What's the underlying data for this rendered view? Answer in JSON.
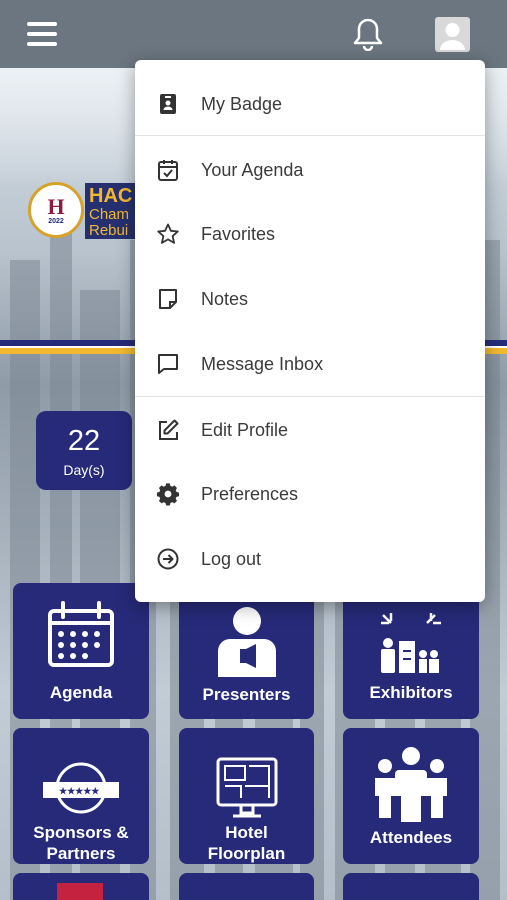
{
  "header": {
    "menu_icon": "hamburger-icon",
    "bell_icon": "bell-icon",
    "avatar_icon": "user-avatar-icon"
  },
  "hero": {
    "logo": {
      "initial": "H",
      "year": "2022",
      "line1": "HAC",
      "line2": "Cham",
      "line3": "Rebui"
    },
    "countdown": {
      "value": "22",
      "unit": "Day(s)"
    }
  },
  "colors": {
    "topbar": "#6b7680",
    "tile": "#262a78",
    "gold": "#f0b930"
  },
  "user_menu": {
    "items": [
      {
        "label": "My Badge",
        "icon": "badge-icon"
      },
      {
        "label": "Your Agenda",
        "icon": "calendar-check-icon"
      },
      {
        "label": "Favorites",
        "icon": "star-icon"
      },
      {
        "label": "Notes",
        "icon": "note-icon"
      },
      {
        "label": "Message Inbox",
        "icon": "message-icon"
      },
      {
        "label": "Edit Profile",
        "icon": "edit-icon"
      },
      {
        "label": "Preferences",
        "icon": "gear-icon"
      },
      {
        "label": "Log out",
        "icon": "logout-icon"
      }
    ]
  },
  "tiles": [
    {
      "label": "Agenda",
      "icon": "calendar-icon"
    },
    {
      "label": "Presenters",
      "icon": "presenter-icon"
    },
    {
      "label": "Exhibitors",
      "icon": "exhibitors-icon"
    },
    {
      "label_line1": "Sponsors &",
      "label_line2": "Partners",
      "icon": "sponsor-badge-icon"
    },
    {
      "label_line1": "Hotel",
      "label_line2": "Floorplan",
      "icon": "floorplan-icon"
    },
    {
      "label": "Attendees",
      "icon": "attendees-icon"
    }
  ]
}
